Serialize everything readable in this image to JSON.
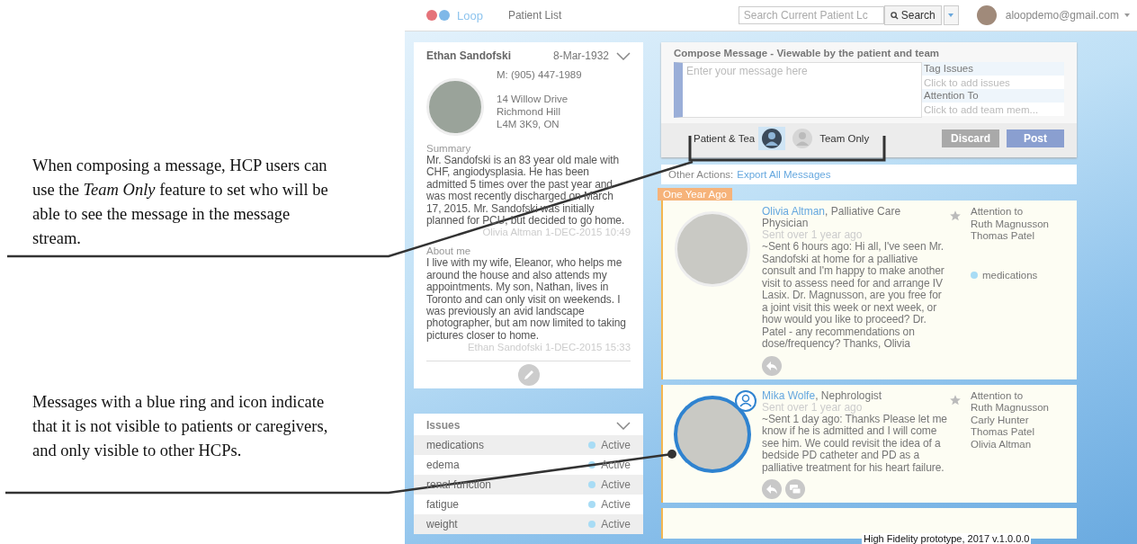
{
  "annotations": [
    {
      "text": "When composing a message, HCP users can use the *Team Only* feature to set who will be able to see the message in the message stream."
    },
    {
      "text": "Messages with a blue ring and icon indicate that it is not visible to patients or caregivers, and only visible to other HCPs."
    }
  ],
  "header": {
    "logo": "Loop",
    "nav": "Patient List",
    "search_placeholder": "Search Current Patient Lc",
    "search_button": "Search",
    "user": "aloopdemo@gmail.com"
  },
  "patient": {
    "name": "Ethan Sandofski",
    "dob": "8-Mar-1932",
    "phone": "M: (905) 447-1989",
    "address": [
      "14 Willow Drive",
      "Richmond Hill",
      "L4M 3K9, ON"
    ],
    "summary_label": "Summary",
    "summary": "Mr. Sandofski is an 83 year old male with CHF, angiodysplasia. He has been admitted 5 times over the past year and was most recently discharged on March 17, 2015. Mr. Sandofski was initially planned for PCU, but decided to go home.",
    "summary_byline": "Olivia Altman 1-DEC-2015 10:49",
    "about_label": "About me",
    "about": "I live with my wife, Eleanor, who helps me around the house and also attends my appointments. My son, Nathan, lives in Toronto and can only visit on weekends. I was previously an avid landscape photographer, but am now limited to taking pictures closer to home.",
    "about_byline": "Ethan Sandofski 1-DEC-2015 15:33"
  },
  "issues": {
    "title": "Issues",
    "items": [
      {
        "name": "medications",
        "status": "Active",
        "color": "#a8dcf5"
      },
      {
        "name": "edema",
        "status": "Active",
        "color": "#a8dcf5"
      },
      {
        "name": "renal function",
        "status": "Active",
        "color": "#a8dcf5"
      },
      {
        "name": "fatigue",
        "status": "Active",
        "color": "#a8dcf5"
      },
      {
        "name": "weight",
        "status": "Active",
        "color": "#a8dcf5"
      }
    ]
  },
  "compose": {
    "title": "Compose Message - Viewable by the patient and team",
    "placeholder": "Enter your message here",
    "tag_label": "Tag Issues",
    "tag_placeholder": "Click to add issues",
    "attention_label": "Attention To",
    "attention_placeholder": "Click to add team mem...",
    "visibility": [
      {
        "label": "Patient & Tea",
        "selected": true
      },
      {
        "label": "Team Only",
        "selected": false
      }
    ],
    "discard": "Discard",
    "post": "Post"
  },
  "other_actions": {
    "label": "Other Actions:",
    "link": "Export All Messages"
  },
  "period_label": "One Year Ago",
  "messages": [
    {
      "author": "Olivia Altman",
      "role": ", Palliative Care Physician",
      "sent": "Sent over 1 year ago",
      "body": "~Sent 6 hours ago: Hi all, I've seen Mr. Sandofski at home for a palliative consult and I'm happy to make another visit to assess need for and arrange IV Lasix. Dr. Magnusson, are you free for a joint visit this week or next week, or how would you like to proceed? Dr. Patel - any recommendations on dose/frequency? Thanks, Olivia",
      "attention_label": "Attention to",
      "attention": [
        "Ruth Magnusson",
        "Thomas Patel"
      ],
      "tags": [
        {
          "name": "medications",
          "color": "#a8dcf5"
        }
      ],
      "team_only": false,
      "actions": [
        {
          "kind": "reply"
        }
      ]
    },
    {
      "author": "Mika Wolfe",
      "role": ", Nephrologist",
      "sent": "Sent over 1 year ago",
      "body": "~Sent 1 day ago: Thanks Please let me know if he is admitted and I will come see him. We could revisit the idea of a bedside PD catheter and PD as a palliative treatment for his heart failure.",
      "attention_label": "Attention to",
      "attention": [
        "Ruth Magnusson",
        "Carly Hunter",
        "Thomas Patel",
        "Olivia Altman"
      ],
      "team_only": true,
      "actions": [
        {
          "kind": "reply"
        },
        {
          "kind": "chat"
        }
      ]
    }
  ],
  "caption": "High Fidelity prototype, 2017 v.1.0.0.0"
}
